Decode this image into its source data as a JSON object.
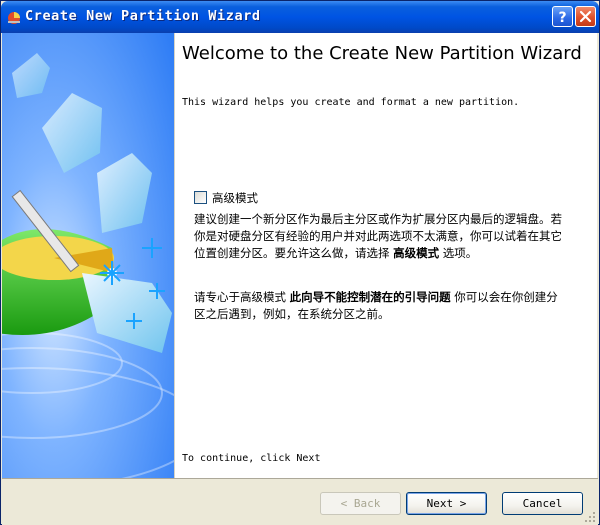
{
  "window": {
    "title": "Create New Partition Wizard"
  },
  "content": {
    "heading": "Welcome to the Create New Partition Wizard",
    "intro": "This wizard helps you create and format a new partition.",
    "advanced_checkbox": {
      "label": "高级模式",
      "checked": false
    },
    "paragraph1": {
      "text": "建议创建一个新分区作为最后主分区或作为扩展分区内最后的逻辑盘。若你是对硬盘分区有经验的用户并对此两选项不太满意，你可以试着在其它位置创建分区。要允许这么做，请选择 ",
      "bold": "高级模式",
      "after": " 选项。"
    },
    "paragraph2": {
      "text": "请专心于高级模式 ",
      "bold": "此向导不能控制潜在的引导问题",
      "after": " 你可以会在你创建分区之后遇到，例如，在系统分区之前。"
    },
    "continue_text": "To continue, click Next"
  },
  "buttons": {
    "back": "< Back",
    "next": "Next >",
    "cancel": "Cancel"
  },
  "colors": {
    "titlebar": "#0054e3",
    "panel": "#3a88ff",
    "accent_green": "#22b814"
  }
}
